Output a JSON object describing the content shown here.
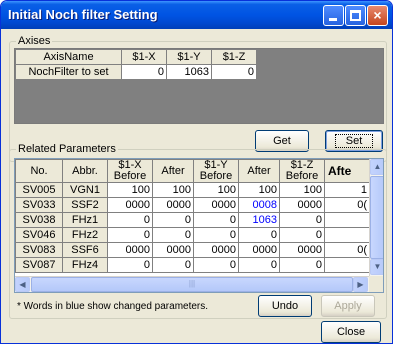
{
  "window": {
    "title": "Initial Noch filter Setting",
    "minimize_glyph": "",
    "maximize_glyph": "",
    "close_glyph": "×"
  },
  "axises": {
    "legend": "Axises",
    "headers": [
      "AxisName",
      "$1-X",
      "$1-Y",
      "$1-Z"
    ],
    "row_label": "NochFilter to set",
    "values": [
      "0",
      "1063",
      "0"
    ],
    "get_label": "Get",
    "set_label": "Set"
  },
  "related": {
    "legend": "Related Parameters",
    "headers": [
      "No.",
      "Abbr.",
      "$1-X\nBefore",
      "After",
      "$1-Y\nBefore",
      "After",
      "$1-Z\nBefore",
      "Afte"
    ],
    "rows": [
      {
        "no": "SV005",
        "abbr": "VGN1",
        "vals": [
          "100",
          "100",
          "100",
          "100",
          "100",
          "1"
        ]
      },
      {
        "no": "SV033",
        "abbr": "SSF2",
        "vals": [
          "0000",
          "0000",
          "0000",
          "0008",
          "0000",
          "0("
        ]
      },
      {
        "no": "SV038",
        "abbr": "FHz1",
        "vals": [
          "0",
          "0",
          "0",
          "1063",
          "0",
          ""
        ]
      },
      {
        "no": "SV046",
        "abbr": "FHz2",
        "vals": [
          "0",
          "0",
          "0",
          "0",
          "0",
          ""
        ]
      },
      {
        "no": "SV083",
        "abbr": "SSF6",
        "vals": [
          "0000",
          "0000",
          "0000",
          "0000",
          "0000",
          "0("
        ]
      },
      {
        "no": "SV087",
        "abbr": "FHz4",
        "vals": [
          "0",
          "0",
          "0",
          "0",
          "0",
          ""
        ]
      }
    ],
    "changed_cells": [
      {
        "row": 1,
        "col": 3
      },
      {
        "row": 2,
        "col": 3
      }
    ],
    "changed_color": "#0000ff",
    "note": "* Words in blue show changed parameters.",
    "undo_label": "Undo",
    "apply_label": "Apply"
  },
  "footer": {
    "close_label": "Close"
  },
  "scrollbars": {
    "up_glyph": "▲",
    "down_glyph": "▼",
    "left_glyph": "◀",
    "right_glyph": "▶",
    "thumb_grip": "|||"
  }
}
